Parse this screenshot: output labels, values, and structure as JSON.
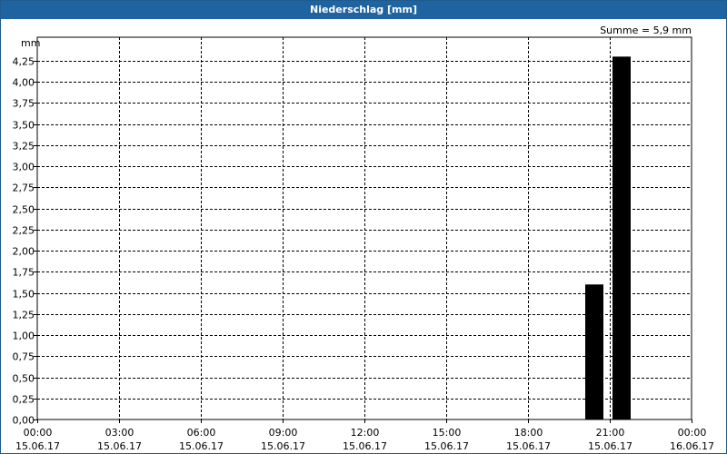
{
  "window": {
    "title": "Niederschlag [mm]"
  },
  "chart_data": {
    "type": "bar",
    "title": "Niederschlag [mm]",
    "ylabel": "mm",
    "annotation": "Summe = 5,9 mm",
    "ylim": [
      0,
      4.25
    ],
    "y_ticks": [
      "0,00",
      "0,25",
      "0,50",
      "0,75",
      "1,00",
      "1,25",
      "1,50",
      "1,75",
      "2,00",
      "2,25",
      "2,50",
      "2,75",
      "3,00",
      "3,25",
      "3,50",
      "3,75",
      "4,00",
      "4,25"
    ],
    "x_range_hours": [
      0,
      24
    ],
    "x_ticks": [
      {
        "time": "00:00",
        "date": "15.06.17"
      },
      {
        "time": "03:00",
        "date": "15.06.17"
      },
      {
        "time": "06:00",
        "date": "15.06.17"
      },
      {
        "time": "09:00",
        "date": "15.06.17"
      },
      {
        "time": "12:00",
        "date": "15.06.17"
      },
      {
        "time": "15:00",
        "date": "15.06.17"
      },
      {
        "time": "18:00",
        "date": "15.06.17"
      },
      {
        "time": "21:00",
        "date": "15.06.17"
      },
      {
        "time": "00:00",
        "date": "16.06.17"
      }
    ],
    "bars": [
      {
        "start": "20:00",
        "end": "21:00",
        "value": 1.6
      },
      {
        "start": "21:00",
        "end": "22:00",
        "value": 4.3
      }
    ],
    "grid": true,
    "bar_color": "#000000",
    "grid_color": "#000000"
  }
}
